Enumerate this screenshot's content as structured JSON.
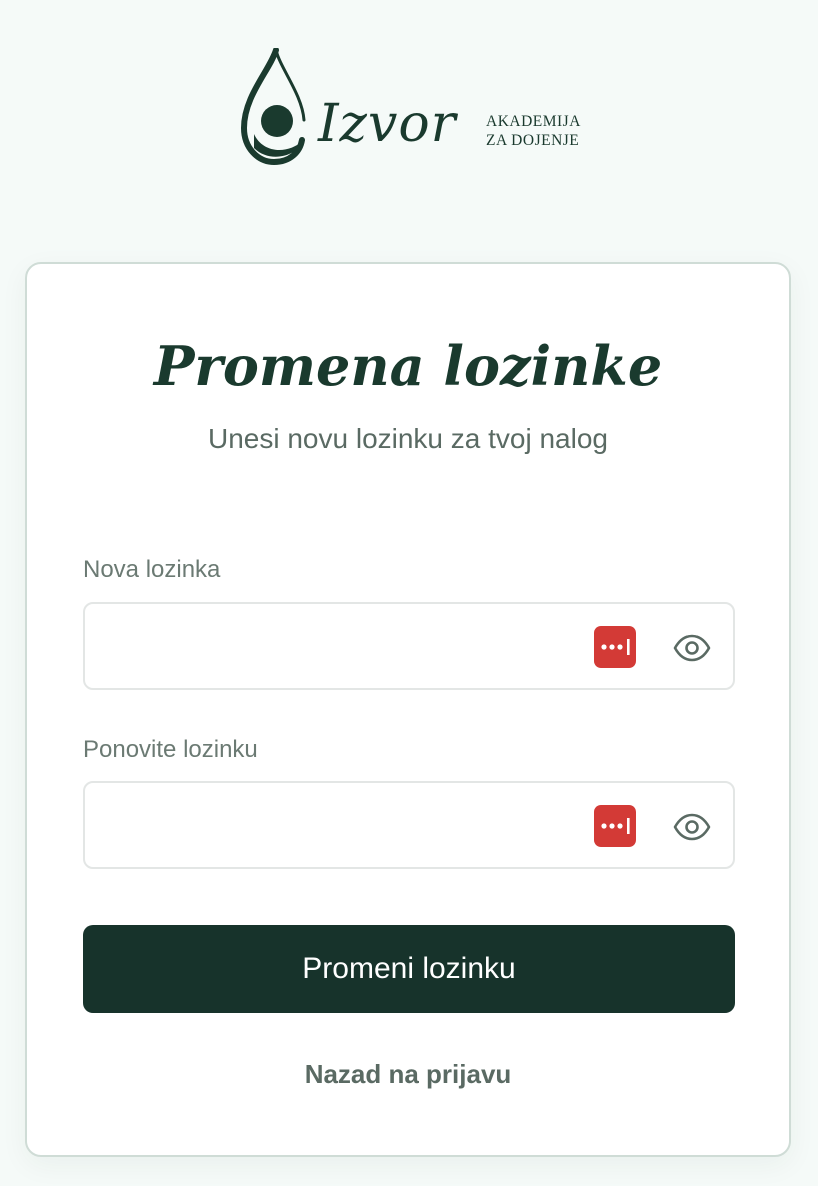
{
  "brand": {
    "logo_word": "Izvor",
    "tagline_line1": "AKADEMIJA",
    "tagline_line2": "ZA DOJENJE",
    "color": "#1a3a2e"
  },
  "form": {
    "title": "Promena lozinke",
    "subtitle": "Unesi novu lozinku za tvoj nalog",
    "fields": [
      {
        "label": "Nova lozinka",
        "value": "",
        "placeholder": "",
        "type": "password"
      },
      {
        "label": "Ponovite lozinku",
        "value": "",
        "placeholder": "",
        "type": "password"
      }
    ],
    "submit_label": "Promeni lozinku",
    "back_link": "Nazad na prijavu"
  },
  "icons": {
    "password_manager": "password-manager-icon",
    "show_password": "eye-icon"
  },
  "colors": {
    "background": "#f5faf8",
    "primary_button": "#17332b",
    "password_manager_badge": "#d33a36",
    "muted_text": "#5a6a63"
  }
}
